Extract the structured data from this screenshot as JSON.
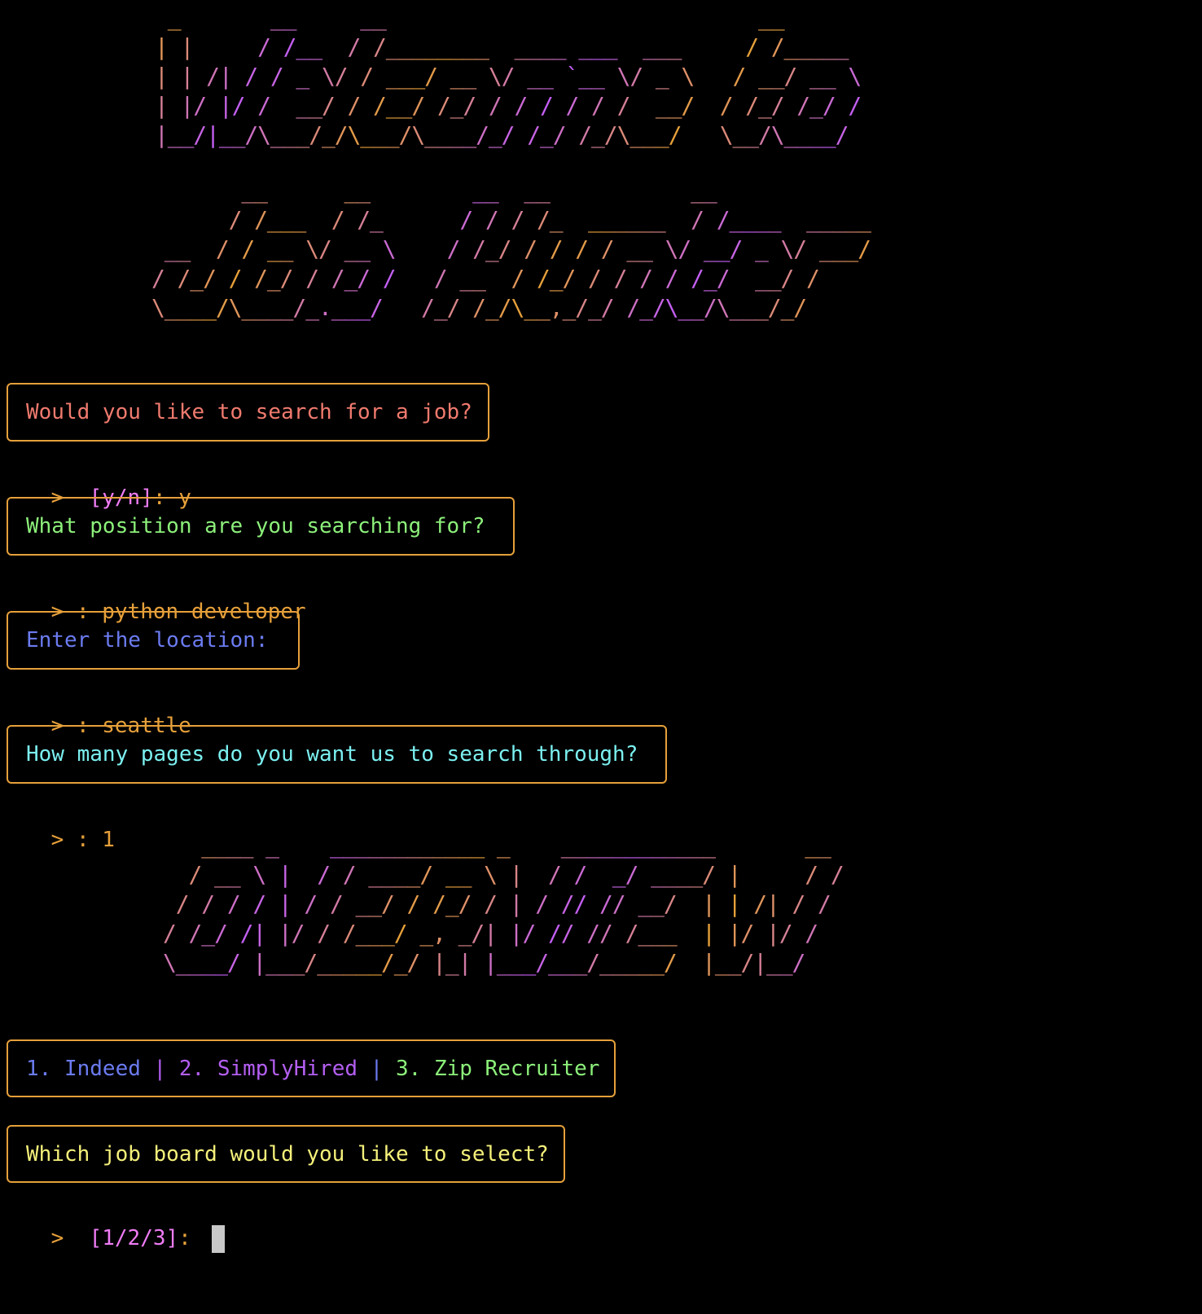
{
  "colors": {
    "background": "#000000",
    "border_orange": "#e6a03a",
    "ascii_orange": "#e6a03a",
    "ascii_magenta": "#c45ff3",
    "question_red": "#f07a6e",
    "question_green": "#8cf07a",
    "question_blue": "#6b7bf0",
    "question_cyan": "#7cf0f0",
    "question_yellow": "#f4f07a",
    "prompt_magenta": "#f07cf6",
    "option_indeed": "#6b7bf0",
    "option_simplyhired": "#b45ff3",
    "option_ziprecruiter": "#8cf07a",
    "cursor": "#c8c8c8"
  },
  "banners": {
    "welcome": " _       __     __                             __     \n| |     / /__  / /________  ____ ___  ___     / /_____\n| | /| / / _ \\/ / ___/ __ \\/ __ `__ \\/ _ \\   / __/ __ \\\n| |/ |/ /  __/ / /__/ /_/ / / / / / /  __/  / /_/ /_/ /\n|__/|__/\\___/_/\\___/\\____/_/ /_/ /_/\\___/   \\__/\\____/",
    "job_hunter": "       __      __        __  __           __           \n      / /___  / /_      / / / /_  ______  / /____  _____\n __  / / __ \\/ __ \\    / /_/ / / / / __ \\/ __/ _ \\/ ___/\n/ /_/ / /_/ / /_/ /   / __  / /_/ / / / / /_/  __/ /    \n\\____/\\____/_.___/   /_/ /_/\\__,_/_/ /_/\\__/\\___/_/     ",
    "overview": "   ____ _    ____________ _    ____________       __\n  / __ \\ |  / / ____/ __ \\ |  / /  _/ ____/ |     / /\n / / / / | / / __/ / /_/ / | / // // __/  | | /| / / \n/ /_/ /| |/ / /___/ _, _/| |/ // // /___  | |/ |/ /  \n\\____/ |___/_____/_/ |_| |___/___/_____/  |__/|__/   "
  },
  "questions": {
    "search": "Would you like to search for a job?",
    "position": "What position are you searching for?",
    "location": "Enter the location:",
    "pages": "How many pages do you want us to search through?",
    "board": "Which job board would you like to select?"
  },
  "prompts": {
    "arrow": ">",
    "yn_choices": "[y/n]",
    "yn_separator": ": ",
    "yn_answer": "y",
    "position_answer": ": python developer",
    "location_answer": ": seattle",
    "pages_answer": ": 1",
    "board_choices": "[1/2/3]",
    "board_separator": ": "
  },
  "job_boards": {
    "option_1": "1. Indeed",
    "option_2": "2. SimplyHired",
    "option_3": "3. Zip Recruiter",
    "separator": "|"
  }
}
